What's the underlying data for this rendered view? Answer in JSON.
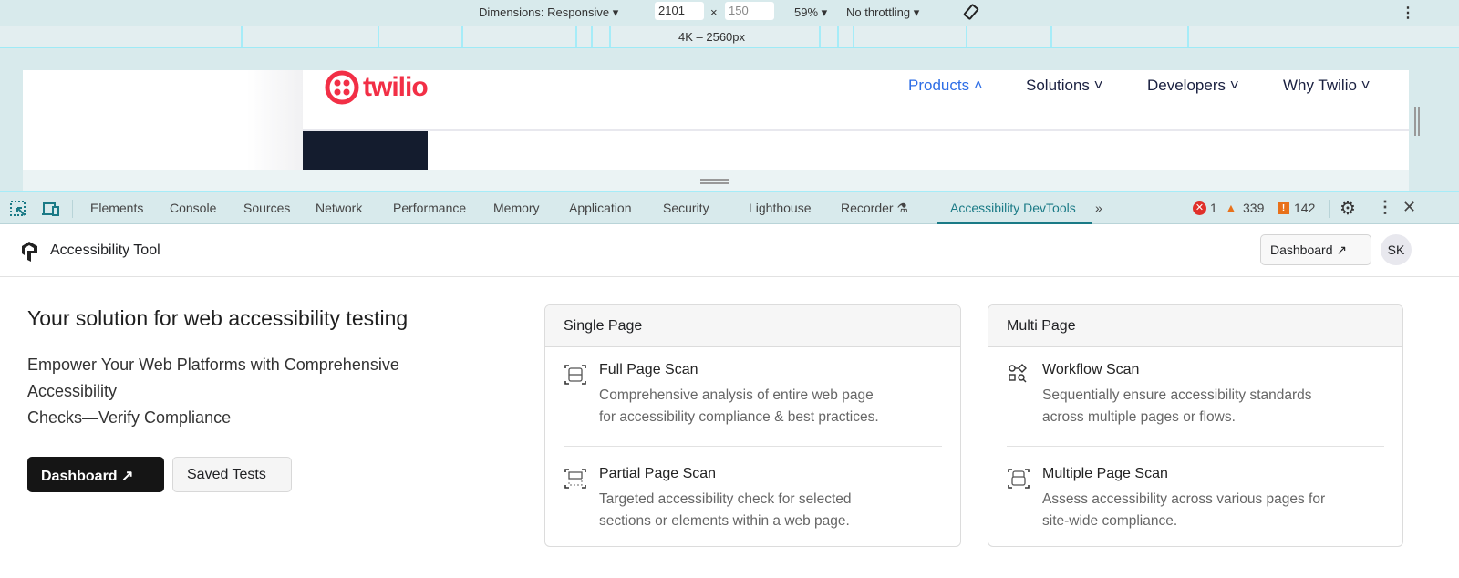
{
  "emulation": {
    "dimensions_label": "Dimensions: Responsive",
    "width": "2101",
    "times": "×",
    "height": "150",
    "zoom": "59%",
    "throttling": "No throttling",
    "ruler_label": "4K – 2560px"
  },
  "site": {
    "logo": "twilio",
    "nav": [
      {
        "label": "Products"
      },
      {
        "label": "Solutions"
      },
      {
        "label": "Developers"
      },
      {
        "label": "Why Twilio"
      }
    ]
  },
  "devtools": {
    "tabs": [
      "Elements",
      "Console",
      "Sources",
      "Network",
      "Performance",
      "Memory",
      "Application",
      "Security",
      "Lighthouse",
      "Recorder",
      "Accessibility DevTools"
    ],
    "errors": "1",
    "warnings": "339",
    "issues": "142",
    "colors": {
      "active": "#1a7a86",
      "error": "#e0302a",
      "warning": "#e8711a"
    }
  },
  "app": {
    "title": "Accessibility Tool",
    "dashboard_label": "Dashboard",
    "avatar": "SK"
  },
  "hero": {
    "heading": "Your solution for web accessibility testing",
    "subtitle_1": "Empower Your Web Platforms with Comprehensive",
    "subtitle_2": "Accessibility",
    "subtitle_3": "Checks—Verify Compliance",
    "dashboard_btn": "Dashboard",
    "saved_btn": "Saved Tests"
  },
  "cards": [
    {
      "title": "Single Page",
      "items": [
        {
          "title": "Full Page Scan",
          "desc1": "Comprehensive analysis of entire web page",
          "desc2": "for accessibility compliance & best practices."
        },
        {
          "title": "Partial Page Scan",
          "desc1": "Targeted accessibility check for selected",
          "desc2": "sections or elements within a web page."
        }
      ]
    },
    {
      "title": "Multi Page",
      "items": [
        {
          "title": "Workflow Scan",
          "desc1": "Sequentially ensure accessibility standards",
          "desc2": "across multiple pages or flows."
        },
        {
          "title": "Multiple Page Scan",
          "desc1": "Assess accessibility across various pages for",
          "desc2": "site-wide compliance."
        }
      ]
    }
  ]
}
